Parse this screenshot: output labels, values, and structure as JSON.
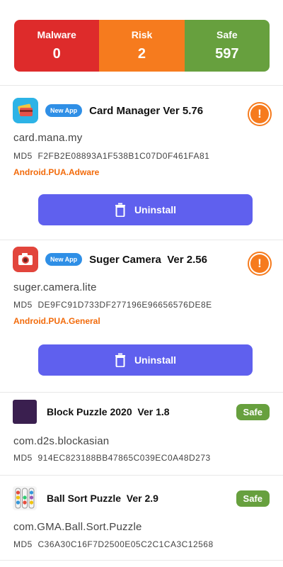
{
  "summary": {
    "malware": {
      "label": "Malware",
      "value": "0"
    },
    "risk": {
      "label": "Risk",
      "value": "2"
    },
    "safe": {
      "label": "Safe",
      "value": "597"
    }
  },
  "apps": [
    {
      "title": "Card Manager Ver 5.76",
      "badge": "New App",
      "package": "card.mana.my",
      "md5": "MD5  F2FB2E08893A1F538B1C07D0F461FA81",
      "threat": "Android.PUA.Adware",
      "status": "risk",
      "action": "Uninstall",
      "icon": "card-manager-icon"
    },
    {
      "title": "Suger Camera  Ver 2.56",
      "badge": "New App",
      "package": "suger.camera.lite",
      "md5": "MD5  DE9FC91D733DF277196E96656576DE8E",
      "threat": "Android.PUA.General",
      "status": "risk",
      "action": "Uninstall",
      "icon": "camera-icon"
    },
    {
      "title": "Block Puzzle 2020  Ver 1.8",
      "package": "com.d2s.blockasian",
      "md5": "MD5  914EC823188BB47865C039EC0A48D273",
      "status": "Safe",
      "icon": "block-puzzle-icon"
    },
    {
      "title": "Ball Sort Puzzle  Ver 2.9",
      "package": "com.GMA.Ball.Sort.Puzzle",
      "md5": "MD5  C36A30C16F7D2500E05C2C1CA3C12568",
      "status": "Safe",
      "icon": "ball-sort-icon"
    }
  ],
  "colors": {
    "malware": "#de2b2b",
    "risk": "#f67b1e",
    "safe": "#67a03e",
    "button": "#5f60ee",
    "new_badge": "#2f8fe6"
  }
}
